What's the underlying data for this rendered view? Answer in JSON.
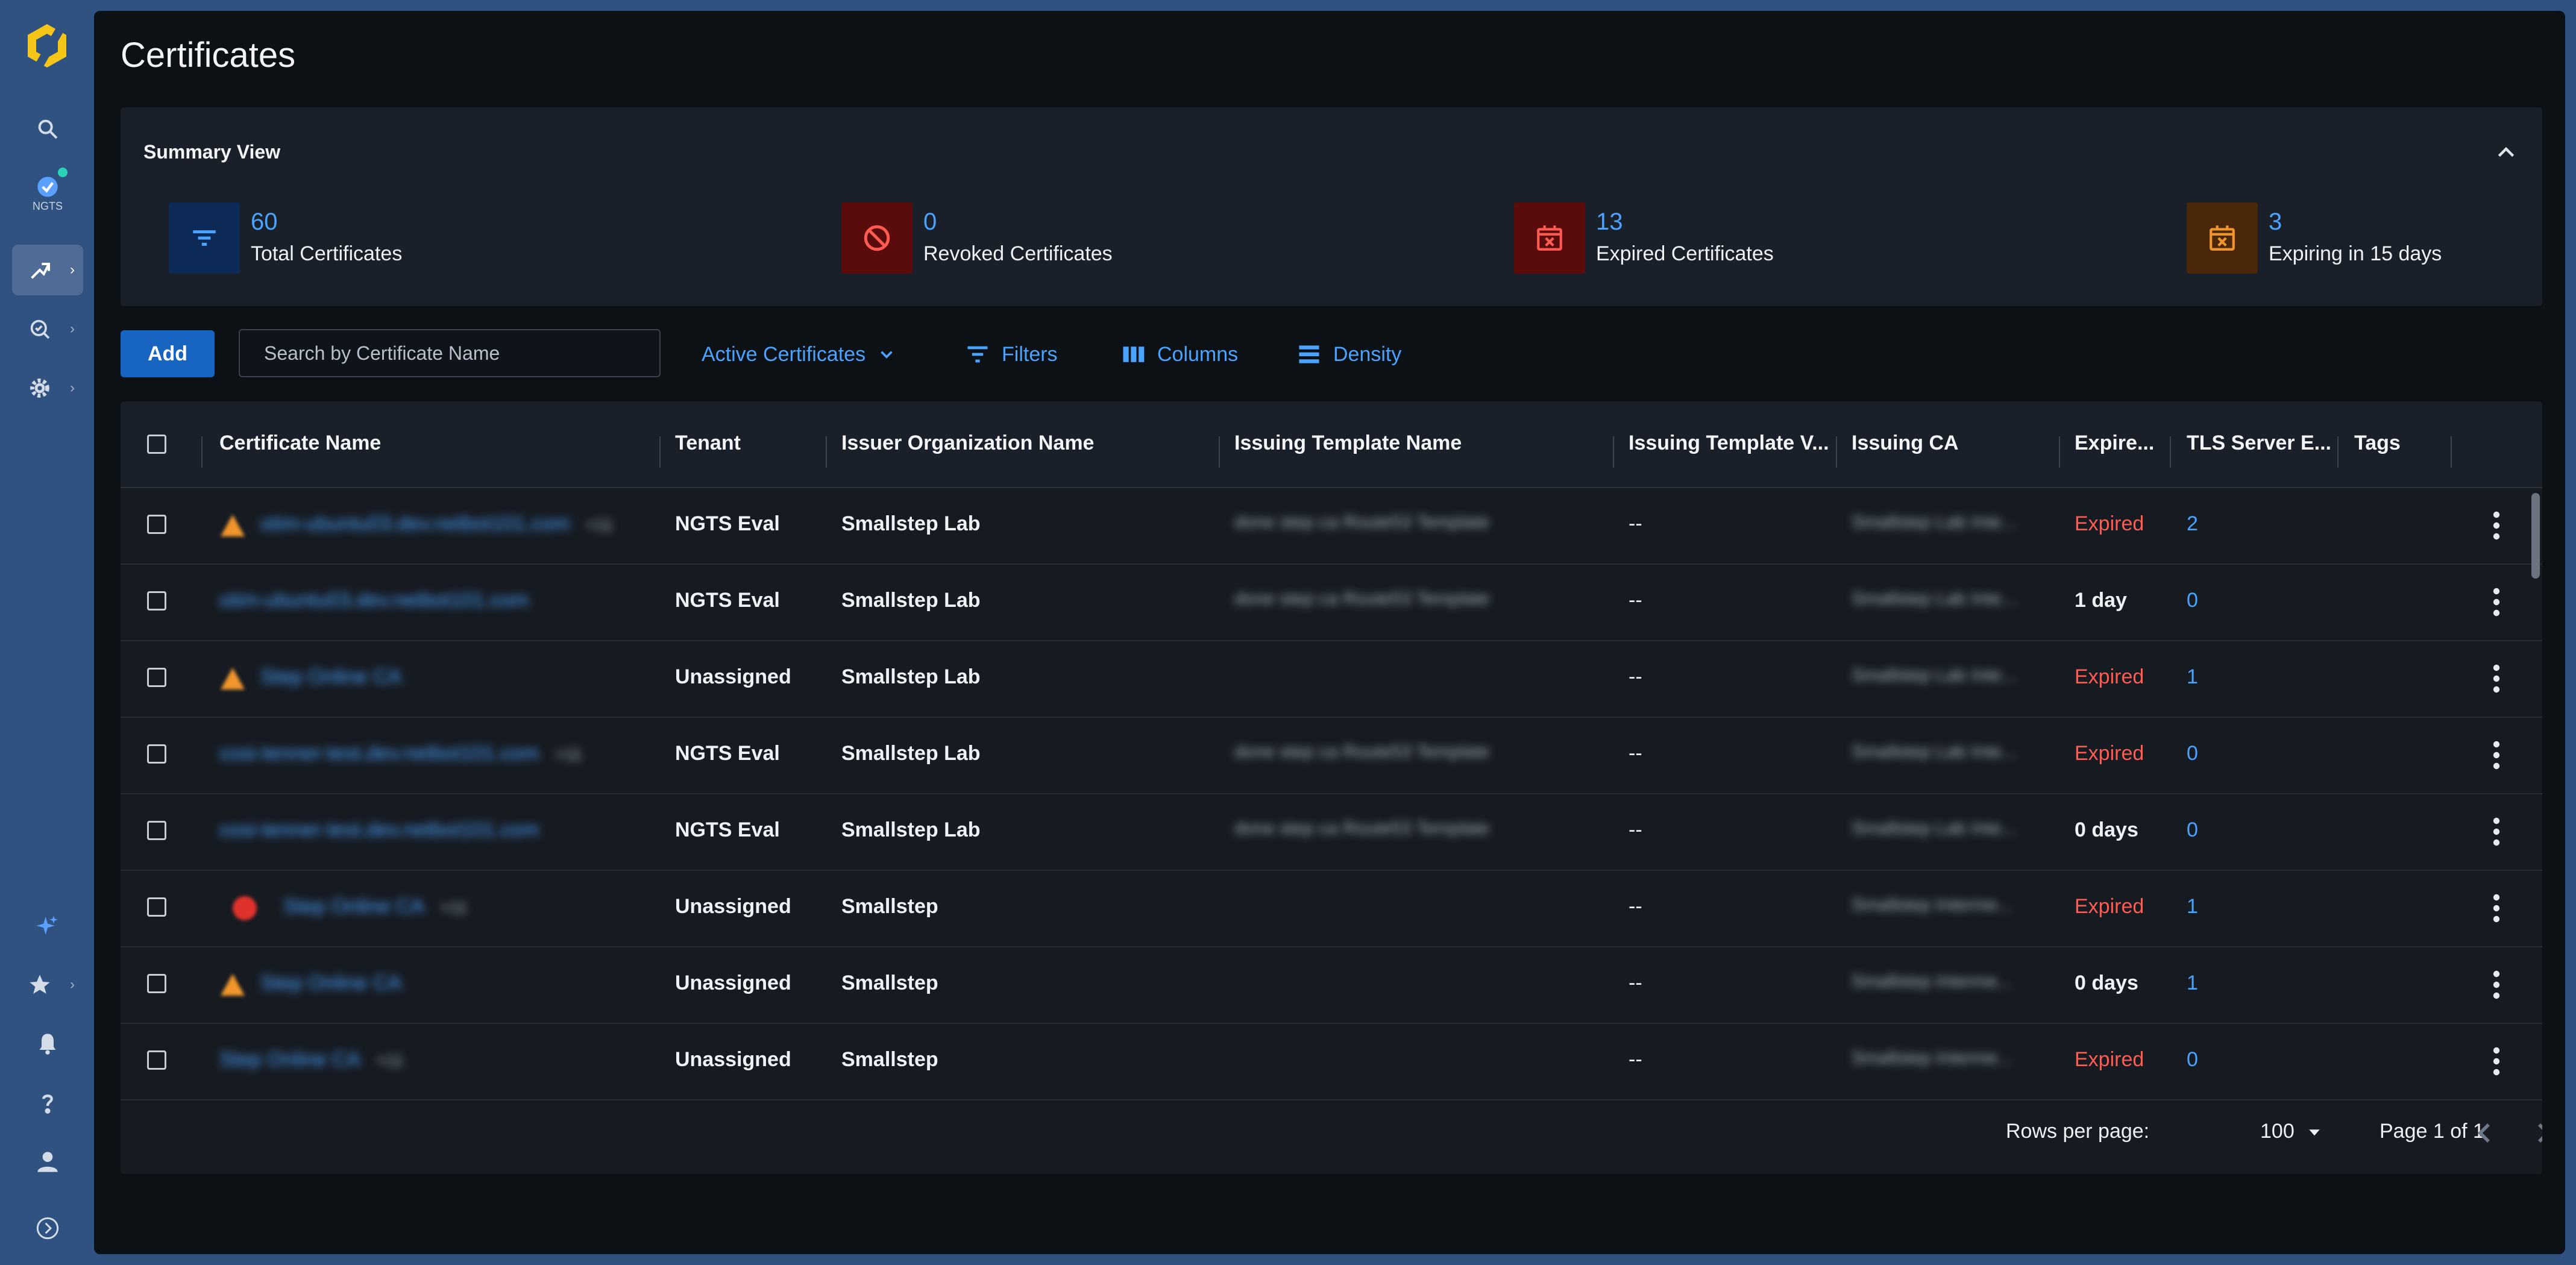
{
  "sidebar": {
    "ngts_label": "NGTS",
    "items": [
      {
        "name": "search"
      },
      {
        "name": "ngts"
      },
      {
        "name": "certificates"
      },
      {
        "name": "discovery"
      },
      {
        "name": "settings"
      },
      {
        "name": "ai-assistant"
      },
      {
        "name": "favorites"
      },
      {
        "name": "notifications"
      },
      {
        "name": "help"
      },
      {
        "name": "profile"
      },
      {
        "name": "expand"
      }
    ]
  },
  "page": {
    "title": "Certificates"
  },
  "summary": {
    "title": "Summary View",
    "metrics": [
      {
        "value": "60",
        "label": "Total Certificates",
        "icon": "filter-icon",
        "bg": "#0c2a55",
        "fg": "#4aa3ff"
      },
      {
        "value": "0",
        "label": "Revoked Certificates",
        "icon": "block-icon",
        "bg": "#5a0b0b",
        "fg": "#ff5b50"
      },
      {
        "value": "13",
        "label": "Expired Certificates",
        "icon": "calendar-x-icon",
        "bg": "#5a0b0b",
        "fg": "#ff5b50"
      },
      {
        "value": "3",
        "label": "Expiring in 15 days",
        "icon": "calendar-x-icon",
        "bg": "#4a2708",
        "fg": "#f0962c"
      }
    ]
  },
  "toolbar": {
    "add_label": "Add",
    "search_placeholder": "Search by Certificate Name",
    "view_label": "Active Certificates",
    "filters_label": "Filters",
    "columns_label": "Columns",
    "density_label": "Density"
  },
  "table": {
    "columns": [
      "Certificate Name",
      "Tenant",
      "Issuer Organization Name",
      "Issuing Template Name",
      "Issuing Template V...",
      "Issuing CA",
      "Expire...",
      "TLS Server E...",
      "Tags"
    ],
    "rows": [
      {
        "status_icon": "warning",
        "name": "otim-ubuntu03.dev.netbot101.com",
        "name_suffix": "+11",
        "tenant": "NGTS Eval",
        "issuer_org": "Smallstep Lab",
        "template": "done step ca Route53 Template",
        "template_version": "--",
        "issuing_ca": "Smallstep Lab Inte...",
        "expires": "Expired",
        "expired": true,
        "tls": "2"
      },
      {
        "status_icon": "",
        "name": "otim-ubuntu03.dev.netbot101.com",
        "name_suffix": "",
        "tenant": "NGTS Eval",
        "issuer_org": "Smallstep Lab",
        "template": "done step ca Route53 Template",
        "template_version": "--",
        "issuing_ca": "Smallstep Lab Inte...",
        "expires": "1 day",
        "expired": false,
        "tls": "0"
      },
      {
        "status_icon": "warning",
        "name": "Step Online CA",
        "name_suffix": "",
        "tenant": "Unassigned",
        "issuer_org": "Smallstep Lab",
        "template": "",
        "template_version": "--",
        "issuing_ca": "Smallstep Lab Inte...",
        "expires": "Expired",
        "expired": true,
        "tls": "1"
      },
      {
        "status_icon": "",
        "name": "cosi-tenner-test.dev.netbot101.com",
        "name_suffix": "+11",
        "tenant": "NGTS Eval",
        "issuer_org": "Smallstep Lab",
        "template": "done step ca Route53 Template",
        "template_version": "--",
        "issuing_ca": "Smallstep Lab Inte...",
        "expires": "Expired",
        "expired": true,
        "tls": "0"
      },
      {
        "status_icon": "",
        "name": "cosi-tenner-test.dev.netbot101.com",
        "name_suffix": "",
        "tenant": "NGTS Eval",
        "issuer_org": "Smallstep Lab",
        "template": "done step ca Route53 Template",
        "template_version": "--",
        "issuing_ca": "Smallstep Lab Inte...",
        "expires": "0 days",
        "expired": false,
        "tls": "0"
      },
      {
        "status_icon": "error",
        "name": "Step Online CA",
        "name_suffix": "+11",
        "tenant": "Unassigned",
        "issuer_org": "Smallstep",
        "template": "",
        "template_version": "--",
        "issuing_ca": "Smallstep Interme...",
        "expires": "Expired",
        "expired": true,
        "tls": "1"
      },
      {
        "status_icon": "warning",
        "name": "Step Online CA",
        "name_suffix": "",
        "tenant": "Unassigned",
        "issuer_org": "Smallstep",
        "template": "",
        "template_version": "--",
        "issuing_ca": "Smallstep Interme...",
        "expires": "0 days",
        "expired": false,
        "tls": "1"
      },
      {
        "status_icon": "",
        "name": "Step Online CA",
        "name_suffix": "+11",
        "tenant": "Unassigned",
        "issuer_org": "Smallstep",
        "template": "",
        "template_version": "--",
        "issuing_ca": "Smallstep Interme...",
        "expires": "Expired",
        "expired": true,
        "tls": "0"
      }
    ]
  },
  "pagination": {
    "rows_per_page_label": "Rows per page:",
    "rows_per_page_value": "100",
    "page_info": "Page 1 of 1"
  }
}
